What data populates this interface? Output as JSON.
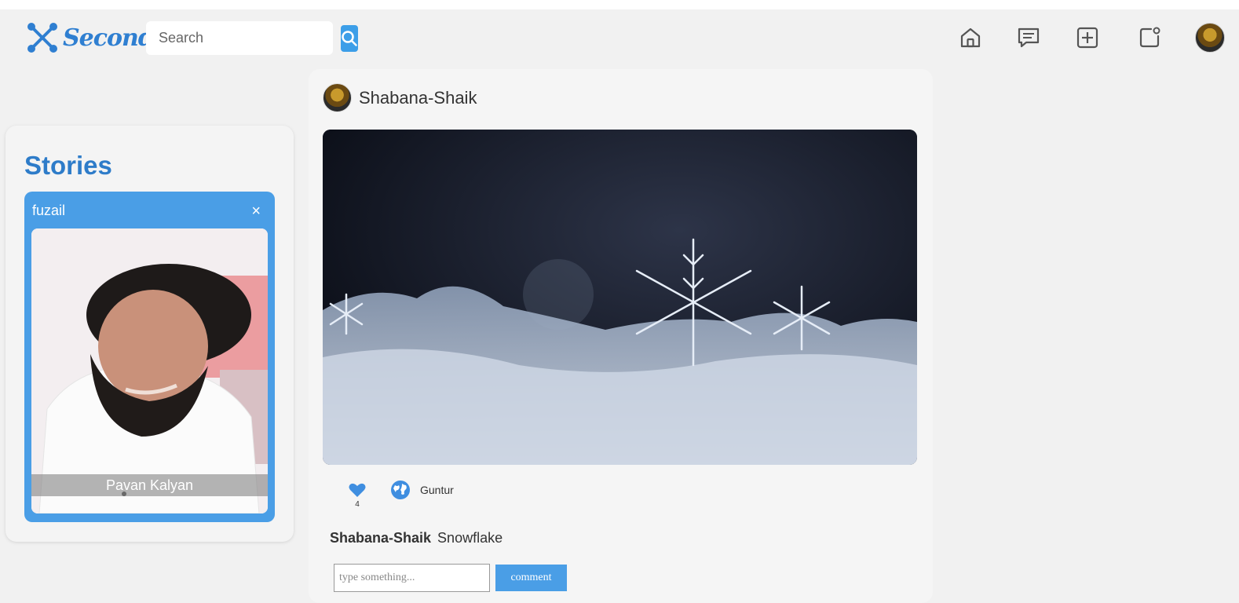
{
  "header": {
    "logo_text": "SecondX",
    "search_placeholder": "Search"
  },
  "stories": {
    "title": "Stories",
    "items": [
      {
        "user": "fuzail",
        "close": "×",
        "caption": "Pavan Kalyan"
      }
    ]
  },
  "post": {
    "author": "Shabana-Shaik",
    "likes": "4",
    "location": "Guntur",
    "caption_author": "Shabana-Shaik",
    "caption_text": "Snowflake",
    "comment_placeholder": "type something...",
    "comment_button": "comment"
  },
  "colors": {
    "accent": "#4a9ee6",
    "title_blue": "#2e7cc9",
    "background": "#f1f1f1"
  }
}
